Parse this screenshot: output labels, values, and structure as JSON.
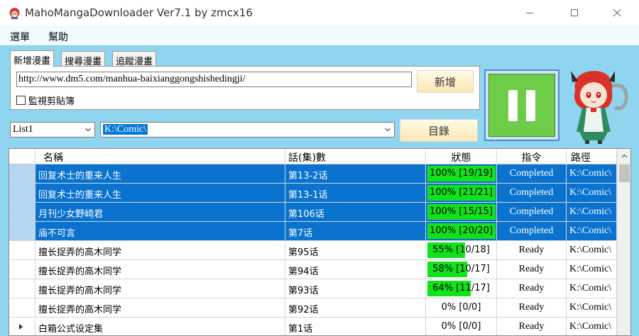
{
  "window": {
    "title": "MahoMangaDownloader Ver7.1 by zmcx16",
    "icon": "app-mascot-icon",
    "controls": [
      "minimize-icon",
      "maximize-icon",
      "close-icon"
    ]
  },
  "menu": {
    "items": [
      {
        "label": "選單"
      },
      {
        "label": "幫助"
      }
    ]
  },
  "tabs": [
    {
      "label": "新增漫畫",
      "active": true
    },
    {
      "label": "搜尋漫畫",
      "active": false
    },
    {
      "label": "追蹤漫畫",
      "active": false
    }
  ],
  "add_panel": {
    "url_value": "http://www.dm5.com/manhua-baixianggongshishedingji/",
    "add_button": "新增",
    "clipboard_checkbox": {
      "label": "監視剪貼簿",
      "checked": false
    }
  },
  "controls": {
    "list_value": "List1",
    "dir_value": "K:\\Comic\\",
    "dir_button": "目錄",
    "pause_button": "pause-icon"
  },
  "table": {
    "headers": [
      "名稱",
      "話(集)數",
      "狀態",
      "指令",
      "路徑"
    ],
    "rows": [
      {
        "name": "回复术士的重来人生",
        "chapter": "第13-2话",
        "status": "100% [19/19]",
        "progress": 1.0,
        "command": "Completed",
        "path": "K:\\Comic\\",
        "selected": true
      },
      {
        "name": "回复术士的重来人生",
        "chapter": "第13-1话",
        "status": "100% [21/21]",
        "progress": 1.0,
        "command": "Completed",
        "path": "K:\\Comic\\",
        "selected": true
      },
      {
        "name": "月刊少女野崎君",
        "chapter": "第106话",
        "status": "100% [15/15]",
        "progress": 1.0,
        "command": "Completed",
        "path": "K:\\Comic\\",
        "selected": true
      },
      {
        "name": "庙不可言",
        "chapter": "第7话",
        "status": "100% [20/20]",
        "progress": 1.0,
        "command": "Completed",
        "path": "K:\\Comic\\",
        "selected": true
      },
      {
        "name": "擅长捉弄的高木同学",
        "chapter": "第95话",
        "status": "55% [10/18]",
        "progress": 0.55,
        "command": "Ready",
        "path": "K:\\Comic\\",
        "selected": false
      },
      {
        "name": "擅长捉弄的高木同学",
        "chapter": "第94话",
        "status": "58% [10/17]",
        "progress": 0.58,
        "command": "Ready",
        "path": "K:\\Comic\\",
        "selected": false
      },
      {
        "name": "擅长捉弄的高木同学",
        "chapter": "第93话",
        "status": "64% [11/17]",
        "progress": 0.64,
        "command": "Ready",
        "path": "K:\\Comic\\",
        "selected": false
      },
      {
        "name": "擅长捉弄的高木同学",
        "chapter": "第92话",
        "status": "0% [0/0]",
        "progress": 0,
        "command": "Ready",
        "path": "K:\\Comic\\",
        "selected": false
      },
      {
        "name": "白箱公式设定集",
        "chapter": "第1话",
        "status": "0% [0/0]",
        "progress": 0,
        "command": "Ready",
        "path": "K:\\Comic\\",
        "selected": false,
        "current": true
      }
    ]
  }
}
